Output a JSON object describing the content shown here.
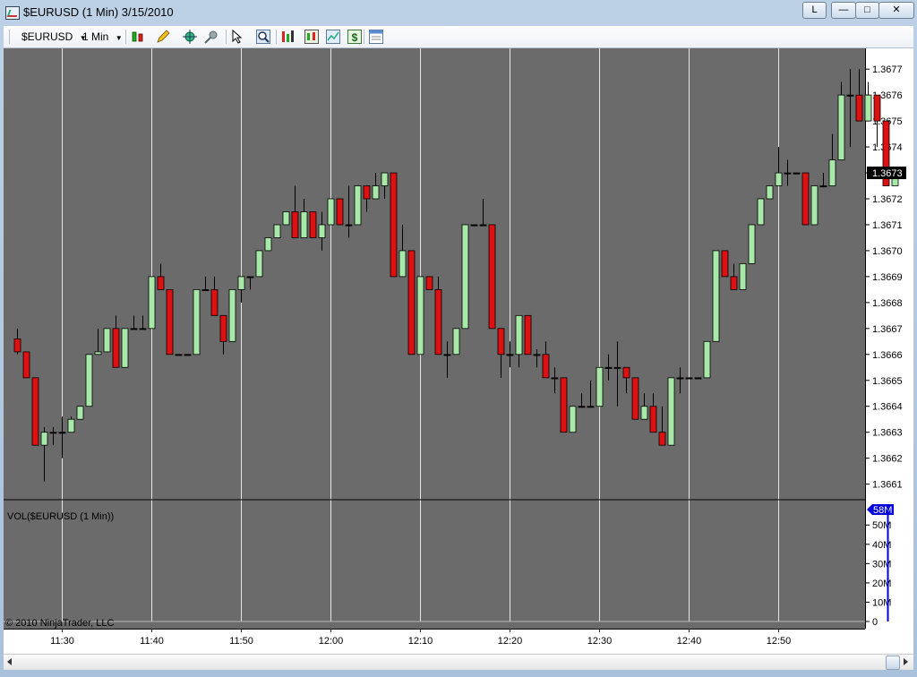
{
  "window": {
    "title": "$EURUSD (1 Min)  3/15/2010",
    "link_button": "L"
  },
  "toolbar": {
    "instrument": "$EURUSD",
    "interval": "1 Min",
    "icons": [
      "candlestick-icon",
      "pencil-icon",
      "crosshair-icon",
      "pin-icon",
      "pointer-icon",
      "zoom-icon",
      "indicators-icon",
      "strategies-icon",
      "chart-style-icon",
      "dollar-icon",
      "properties-icon"
    ]
  },
  "colors": {
    "background": "#6b6b6b",
    "up_candle": "#a8e8a8",
    "down_candle": "#dd1111",
    "grid": "#e8e8e8",
    "volume_bar": "#0000dd",
    "price_marker_bg": "#000000"
  },
  "chart_data": [
    {
      "type": "candlestick",
      "instrument": "$EURUSD",
      "interval": "1 Min",
      "x_ticks": [
        "11:30",
        "11:40",
        "11:50",
        "12:00",
        "12:10",
        "12:20",
        "12:30",
        "12:40",
        "12:50"
      ],
      "y_ticks": [
        "1.3661",
        "1.3662",
        "1.3663",
        "1.3664",
        "1.3665",
        "1.3666",
        "1.3667",
        "1.3668",
        "1.3669",
        "1.3670",
        "1.3671",
        "1.3672",
        "1.3673",
        "1.3674",
        "1.3675",
        "1.3676",
        "1.3677"
      ],
      "ylim": [
        1.36604,
        1.36778
      ],
      "current_price_label": "1.3673",
      "current_price": 1.3673,
      "first_bar_time": "11:25",
      "grid": true,
      "candles": [
        [
          1.36666,
          1.3667,
          1.3666,
          1.36661
        ],
        [
          1.36661,
          1.36661,
          1.36651,
          1.36651
        ],
        [
          1.36651,
          1.36651,
          1.36625,
          1.36625
        ],
        [
          1.36625,
          1.36632,
          1.36611,
          1.3663
        ],
        [
          1.3663,
          1.36632,
          1.36625,
          1.3663
        ],
        [
          1.3663,
          1.36636,
          1.3662,
          1.3663
        ],
        [
          1.3663,
          1.36636,
          1.3663,
          1.36635
        ],
        [
          1.36635,
          1.3664,
          1.36635,
          1.3664
        ],
        [
          1.3664,
          1.3666,
          1.3664,
          1.3666
        ],
        [
          1.3666,
          1.3667,
          1.3666,
          1.36661
        ],
        [
          1.36661,
          1.3667,
          1.36661,
          1.3667
        ],
        [
          1.3667,
          1.36675,
          1.36655,
          1.36655
        ],
        [
          1.36655,
          1.3667,
          1.36655,
          1.3667
        ],
        [
          1.3667,
          1.36675,
          1.3667,
          1.3667
        ],
        [
          1.3667,
          1.36675,
          1.3667,
          1.3667
        ],
        [
          1.3667,
          1.3669,
          1.3667,
          1.3669
        ],
        [
          1.3669,
          1.36695,
          1.36685,
          1.36685
        ],
        [
          1.36685,
          1.36685,
          1.3666,
          1.3666
        ],
        [
          1.3666,
          1.3666,
          1.3666,
          1.3666
        ],
        [
          1.3666,
          1.3666,
          1.3666,
          1.3666
        ],
        [
          1.3666,
          1.36685,
          1.3666,
          1.36685
        ],
        [
          1.36685,
          1.3669,
          1.36685,
          1.36685
        ],
        [
          1.36685,
          1.3669,
          1.36675,
          1.36675
        ],
        [
          1.36675,
          1.36675,
          1.3666,
          1.36665
        ],
        [
          1.36665,
          1.36685,
          1.36665,
          1.36685
        ],
        [
          1.36685,
          1.3669,
          1.3668,
          1.3669
        ],
        [
          1.3669,
          1.3669,
          1.36685,
          1.3669
        ],
        [
          1.3669,
          1.367,
          1.3669,
          1.367
        ],
        [
          1.367,
          1.36705,
          1.367,
          1.36705
        ],
        [
          1.36705,
          1.3671,
          1.36705,
          1.3671
        ],
        [
          1.3671,
          1.36715,
          1.3671,
          1.36715
        ],
        [
          1.36715,
          1.36725,
          1.36705,
          1.36705
        ],
        [
          1.36705,
          1.3672,
          1.36705,
          1.36715
        ],
        [
          1.36715,
          1.36715,
          1.36705,
          1.36705
        ],
        [
          1.36705,
          1.36715,
          1.367,
          1.3671
        ],
        [
          1.3671,
          1.3672,
          1.3671,
          1.3672
        ],
        [
          1.3672,
          1.3672,
          1.3671,
          1.3671
        ],
        [
          1.3671,
          1.36725,
          1.36705,
          1.3671
        ],
        [
          1.3671,
          1.36725,
          1.3671,
          1.36725
        ],
        [
          1.36725,
          1.36725,
          1.36715,
          1.3672
        ],
        [
          1.3672,
          1.3673,
          1.3672,
          1.36725
        ],
        [
          1.36725,
          1.3673,
          1.3672,
          1.3673
        ],
        [
          1.3673,
          1.3673,
          1.3669,
          1.3669
        ],
        [
          1.3669,
          1.3671,
          1.3669,
          1.367
        ],
        [
          1.367,
          1.367,
          1.3666,
          1.3666
        ],
        [
          1.3666,
          1.3669,
          1.3666,
          1.3669
        ],
        [
          1.3669,
          1.3669,
          1.36685,
          1.36685
        ],
        [
          1.36685,
          1.3669,
          1.3666,
          1.3666
        ],
        [
          1.3666,
          1.36665,
          1.36651,
          1.3666
        ],
        [
          1.3666,
          1.3667,
          1.3666,
          1.3667
        ],
        [
          1.3667,
          1.3671,
          1.3667,
          1.3671
        ],
        [
          1.3671,
          1.3671,
          1.3671,
          1.3671
        ],
        [
          1.3671,
          1.3672,
          1.3671,
          1.3671
        ],
        [
          1.3671,
          1.3671,
          1.3667,
          1.3667
        ],
        [
          1.3667,
          1.3667,
          1.36651,
          1.3666
        ],
        [
          1.3666,
          1.36665,
          1.36655,
          1.3666
        ],
        [
          1.3666,
          1.36675,
          1.36655,
          1.36675
        ],
        [
          1.36675,
          1.36675,
          1.3666,
          1.3666
        ],
        [
          1.3666,
          1.36662,
          1.36655,
          1.3666
        ],
        [
          1.3666,
          1.36665,
          1.36651,
          1.36651
        ],
        [
          1.36651,
          1.36655,
          1.36645,
          1.36651
        ],
        [
          1.36651,
          1.36651,
          1.3663,
          1.3663
        ],
        [
          1.3663,
          1.3664,
          1.3663,
          1.3664
        ],
        [
          1.3664,
          1.36645,
          1.3664,
          1.3664
        ],
        [
          1.3664,
          1.3665,
          1.3664,
          1.3664
        ],
        [
          1.3664,
          1.36655,
          1.3664,
          1.36655
        ],
        [
          1.36655,
          1.3666,
          1.3665,
          1.36655
        ],
        [
          1.36655,
          1.36665,
          1.3664,
          1.36655
        ],
        [
          1.36655,
          1.36655,
          1.36645,
          1.36651
        ],
        [
          1.36651,
          1.36651,
          1.36635,
          1.36635
        ],
        [
          1.36635,
          1.36645,
          1.36635,
          1.3664
        ],
        [
          1.3664,
          1.36645,
          1.3663,
          1.3663
        ],
        [
          1.3663,
          1.3664,
          1.36625,
          1.36625
        ],
        [
          1.36625,
          1.36651,
          1.36625,
          1.36651
        ],
        [
          1.36651,
          1.36655,
          1.36645,
          1.36651
        ],
        [
          1.36651,
          1.36651,
          1.36651,
          1.36651
        ],
        [
          1.36651,
          1.36651,
          1.36651,
          1.36651
        ],
        [
          1.36651,
          1.36665,
          1.36651,
          1.36665
        ],
        [
          1.36665,
          1.367,
          1.36665,
          1.367
        ],
        [
          1.367,
          1.367,
          1.3669,
          1.3669
        ],
        [
          1.3669,
          1.36695,
          1.36685,
          1.36685
        ],
        [
          1.36685,
          1.36695,
          1.36685,
          1.36695
        ],
        [
          1.36695,
          1.3671,
          1.36695,
          1.3671
        ],
        [
          1.3671,
          1.3672,
          1.3671,
          1.3672
        ],
        [
          1.3672,
          1.36725,
          1.3672,
          1.36725
        ],
        [
          1.36725,
          1.3674,
          1.36725,
          1.3673
        ],
        [
          1.3673,
          1.36735,
          1.36725,
          1.3673
        ],
        [
          1.3673,
          1.3673,
          1.3673,
          1.3673
        ],
        [
          1.3673,
          1.3673,
          1.3671,
          1.3671
        ],
        [
          1.3671,
          1.36725,
          1.3671,
          1.36725
        ],
        [
          1.36725,
          1.3673,
          1.36725,
          1.36725
        ],
        [
          1.36725,
          1.36745,
          1.36725,
          1.36735
        ],
        [
          1.36735,
          1.36765,
          1.36735,
          1.3676
        ],
        [
          1.3676,
          1.3677,
          1.3674,
          1.3676
        ],
        [
          1.3676,
          1.3677,
          1.3675,
          1.3675
        ],
        [
          1.3675,
          1.36765,
          1.3675,
          1.3676
        ],
        [
          1.3676,
          1.3676,
          1.3674,
          1.3675
        ],
        [
          1.3675,
          1.3675,
          1.36725,
          1.36725
        ],
        [
          1.36725,
          1.3673,
          1.36725,
          1.3673
        ]
      ]
    },
    {
      "type": "bar",
      "label": "VOL($EURUSD (1 Min))",
      "y_ticks": [
        "0",
        "10M",
        "20M",
        "30M",
        "40M",
        "50M"
      ],
      "ylim": [
        0,
        58
      ],
      "current_value_label": "58M",
      "last_bar_value": 58
    }
  ],
  "copyright": "© 2010 NinjaTrader, LLC"
}
